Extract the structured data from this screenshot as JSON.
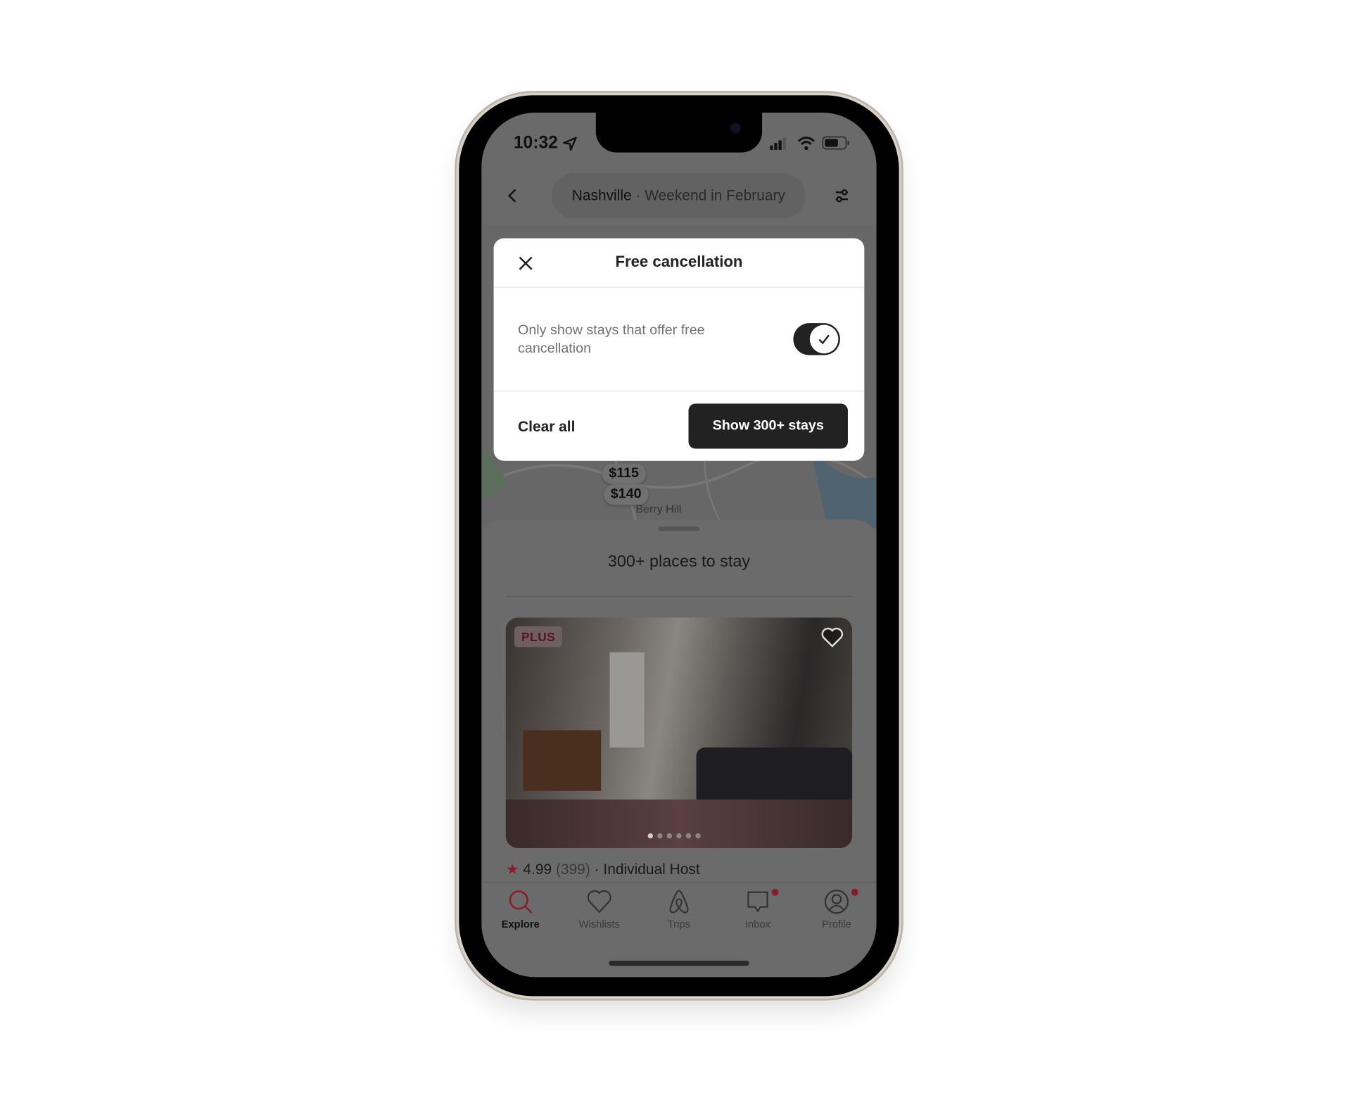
{
  "status_bar": {
    "time": "10:32"
  },
  "header": {
    "back_icon": "chevron-left-icon",
    "location": "Nashville",
    "separator": " · ",
    "dates": "Weekend in February",
    "filter_icon": "sliders-icon"
  },
  "map": {
    "pins": [
      "$115",
      "$140"
    ],
    "place_label": "Berry Hill"
  },
  "results": {
    "title": "300+ places to stay"
  },
  "listing": {
    "badge": "PLUS",
    "rating": "4.99",
    "reviews": "(399)",
    "host": "· Individual Host",
    "photo_count": 6,
    "active_photo": 1
  },
  "tabs": [
    {
      "label": "Explore",
      "icon": "search-icon",
      "active": true
    },
    {
      "label": "Wishlists",
      "icon": "heart-icon"
    },
    {
      "label": "Trips",
      "icon": "airbnb-logo-icon"
    },
    {
      "label": "Inbox",
      "icon": "message-icon",
      "badge": true
    },
    {
      "label": "Profile",
      "icon": "user-circle-icon",
      "badge": true
    }
  ],
  "modal": {
    "title": "Free cancellation",
    "option_label": "Only show stays that offer free cancellation",
    "toggle_on": true,
    "clear_label": "Clear all",
    "show_label": "Show 300+ stays"
  },
  "colors": {
    "accent": "#e31c5f",
    "dark_button": "#222222",
    "dimmed_accent": "#8a1c2a"
  }
}
